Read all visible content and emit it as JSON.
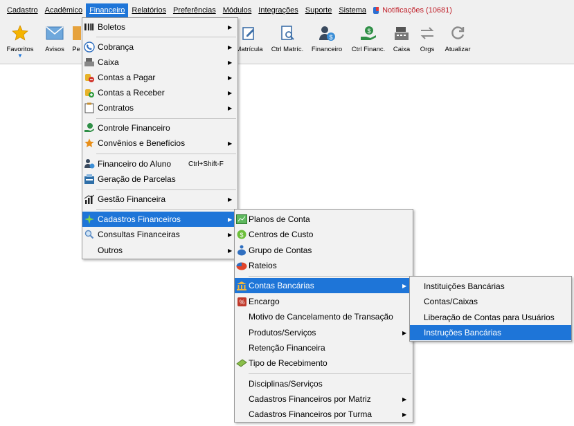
{
  "menubar": {
    "items": [
      "Cadastro",
      "Acadêmico",
      "Financeiro",
      "Relatórios",
      "Preferências",
      "Módulos",
      "Integrações",
      "Suporte",
      "Sistema"
    ],
    "notifications": "Notificações (10681)"
  },
  "toolbar": {
    "favoritos": "Favoritos",
    "avisos": "Avisos",
    "pe": "Pe",
    "matricula": "Matrícula",
    "ctrl_matric": "Ctrl Matríc.",
    "financeiro": "Financeiro",
    "ctrl_financ": "Ctrl Financ.",
    "caixa": "Caixa",
    "orgs": "Orgs",
    "atualizar": "Atualizar"
  },
  "financeiro_menu": {
    "boletos": "Boletos",
    "cobranca": "Cobrança",
    "caixa": "Caixa",
    "contas_pagar": "Contas a Pagar",
    "contas_receber": "Contas a Receber",
    "contratos": "Contratos",
    "controle_financeiro": "Controle Financeiro",
    "convenios": "Convênios e Benefícios",
    "financeiro_aluno": "Financeiro do Aluno",
    "financeiro_aluno_shortcut": "Ctrl+Shift-F",
    "geracao_parcelas": "Geração de Parcelas",
    "gestao_financeira": "Gestão Financeira",
    "cadastros_financeiros": "Cadastros Financeiros",
    "consultas_financeiras": "Consultas Financeiras",
    "outros": "Outros"
  },
  "cadastros_menu": {
    "planos_conta": "Planos de Conta",
    "centros_custo": "Centros de Custo",
    "grupo_contas": "Grupo de Contas",
    "rateios": "Rateios",
    "contas_bancarias": "Contas Bancárias",
    "encargo": "Encargo",
    "motivo_cancelamento": "Motivo de Cancelamento de Transação",
    "produtos_servicos": "Produtos/Serviços",
    "retencao_financeira": "Retenção Financeira",
    "tipo_recebimento": "Tipo de Recebimento",
    "disciplinas_servicos": "Disciplinas/Serviços",
    "por_matriz": "Cadastros Financeiros por Matriz",
    "por_turma": "Cadastros Financeiros por Turma"
  },
  "contas_menu": {
    "instituicoes": "Instituições Bancárias",
    "contas_caixas": "Contas/Caixas",
    "liberacao": "Liberação de Contas para Usuários",
    "instrucoes": "Instruções Bancárias"
  },
  "colors": {
    "highlight": "#1e75d8",
    "menu_bg": "#f2f2f2",
    "toolbar_bg": "#f0f0f0",
    "notification": "#c0202a"
  }
}
